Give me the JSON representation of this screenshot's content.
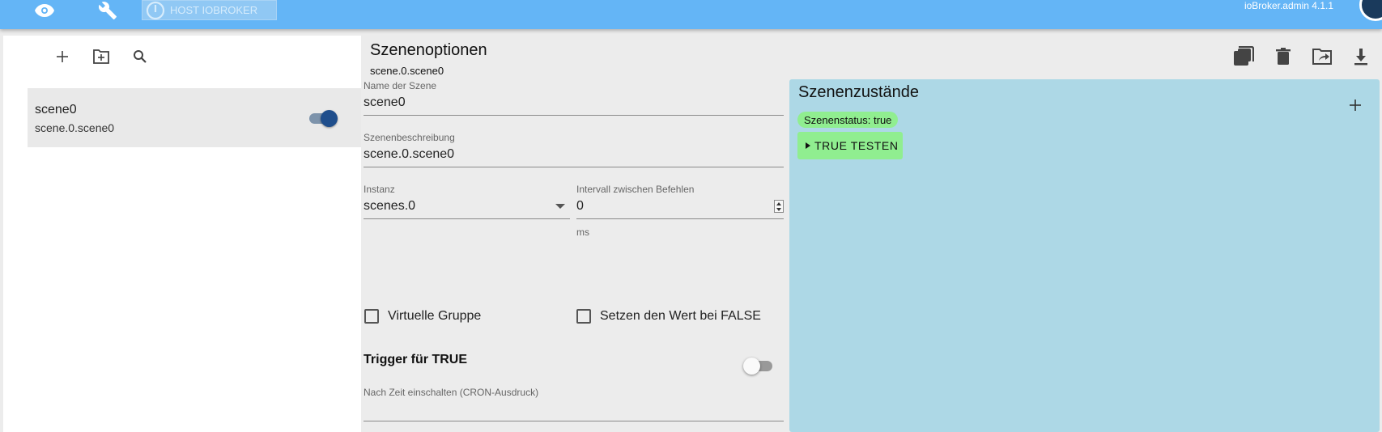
{
  "header": {
    "host_label": "HOST IOBROKER",
    "version": "ioBroker.admin 4.1.1",
    "icons": [
      "eye-icon",
      "wrench-icon",
      "power-icon"
    ]
  },
  "left_panel": {
    "toolbar_icons": [
      "plus-icon",
      "folder-plus-icon",
      "search-icon"
    ],
    "scenes": [
      {
        "name": "scene0",
        "id": "scene.0.scene0",
        "enabled": true
      }
    ]
  },
  "options": {
    "title": "Szenenoptionen",
    "scene_id": "scene.0.scene0",
    "name_label": "Name der Szene",
    "name_value": "scene0",
    "desc_label": "Szenenbeschreibung",
    "desc_value": "scene.0.scene0",
    "instance_label": "Instanz",
    "instance_value": "scenes.0",
    "interval_label": "Intervall zwischen Befehlen",
    "interval_value": "0",
    "interval_unit": "ms",
    "virtual_group_label": "Virtuelle Gruppe",
    "set_false_label": "Setzen den Wert bei FALSE",
    "trigger_title": "Trigger für TRUE",
    "cron_label": "Nach Zeit einschalten (CRON-Ausdruck)",
    "cron_value": ""
  },
  "states": {
    "title": "Szenenzustände",
    "status_chip": "Szenenstatus: true",
    "test_button": "TRUE TESTEN"
  },
  "toolbar_right": {
    "icons": [
      "copy-icon",
      "delete-icon",
      "export-icon",
      "download-icon"
    ]
  },
  "colors": {
    "header": "#64b5f6",
    "states_panel": "#add8e6",
    "chip_green": "#90ee90",
    "switch_active": "#1f4e8c"
  }
}
